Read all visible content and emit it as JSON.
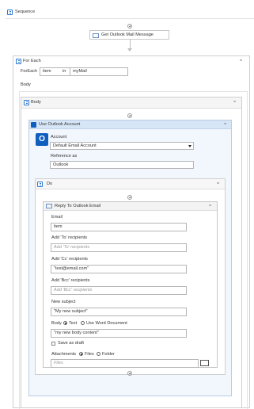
{
  "sequence": {
    "title": "Sequence"
  },
  "get_mail": {
    "label": "Get Outlook Mail Message"
  },
  "for_each": {
    "title": "For Each",
    "foreach_label": "ForEach",
    "item_value": "item",
    "in_label": "in",
    "collection_value": "myMail",
    "body_label": "Body"
  },
  "body_seq": {
    "title": "Body"
  },
  "use_outlook": {
    "title": "Use Outlook Account",
    "account_label": "Account",
    "account_value": "Default Email Account",
    "reference_label": "Reference as",
    "reference_value": "Outlook"
  },
  "do_seq": {
    "title": "Do"
  },
  "reply": {
    "title": "Reply To Outlook Email",
    "email_label": "Email",
    "email_value": "item",
    "to_label": "Add 'To' recipients",
    "to_placeholder": "Add 'To' recipients",
    "cc_label": "Add 'Cc' recipients",
    "cc_value": "\"test@email.com\"",
    "bcc_label": "Add 'Bcc' recipients",
    "bcc_placeholder": "Add 'Bcc' recipients",
    "subject_label": "New subject",
    "subject_value": "\"My new subject\"",
    "body_label": "Body",
    "body_opt_text": "Text",
    "body_opt_word": "Use Word Document",
    "body_value": "\"my new body content\"",
    "save_draft_label": "Save as draft",
    "attachments_label": "Attachments",
    "att_opt_files": "Files",
    "att_opt_folder": "Folder",
    "files_placeholder": "Files"
  },
  "icons": {
    "sequence": "sequence-icon",
    "outlook": "outlook-icon",
    "mail": "mail-icon",
    "add": "add-activity-icon",
    "collapse": "collapse-icon",
    "folder": "folder-icon"
  }
}
